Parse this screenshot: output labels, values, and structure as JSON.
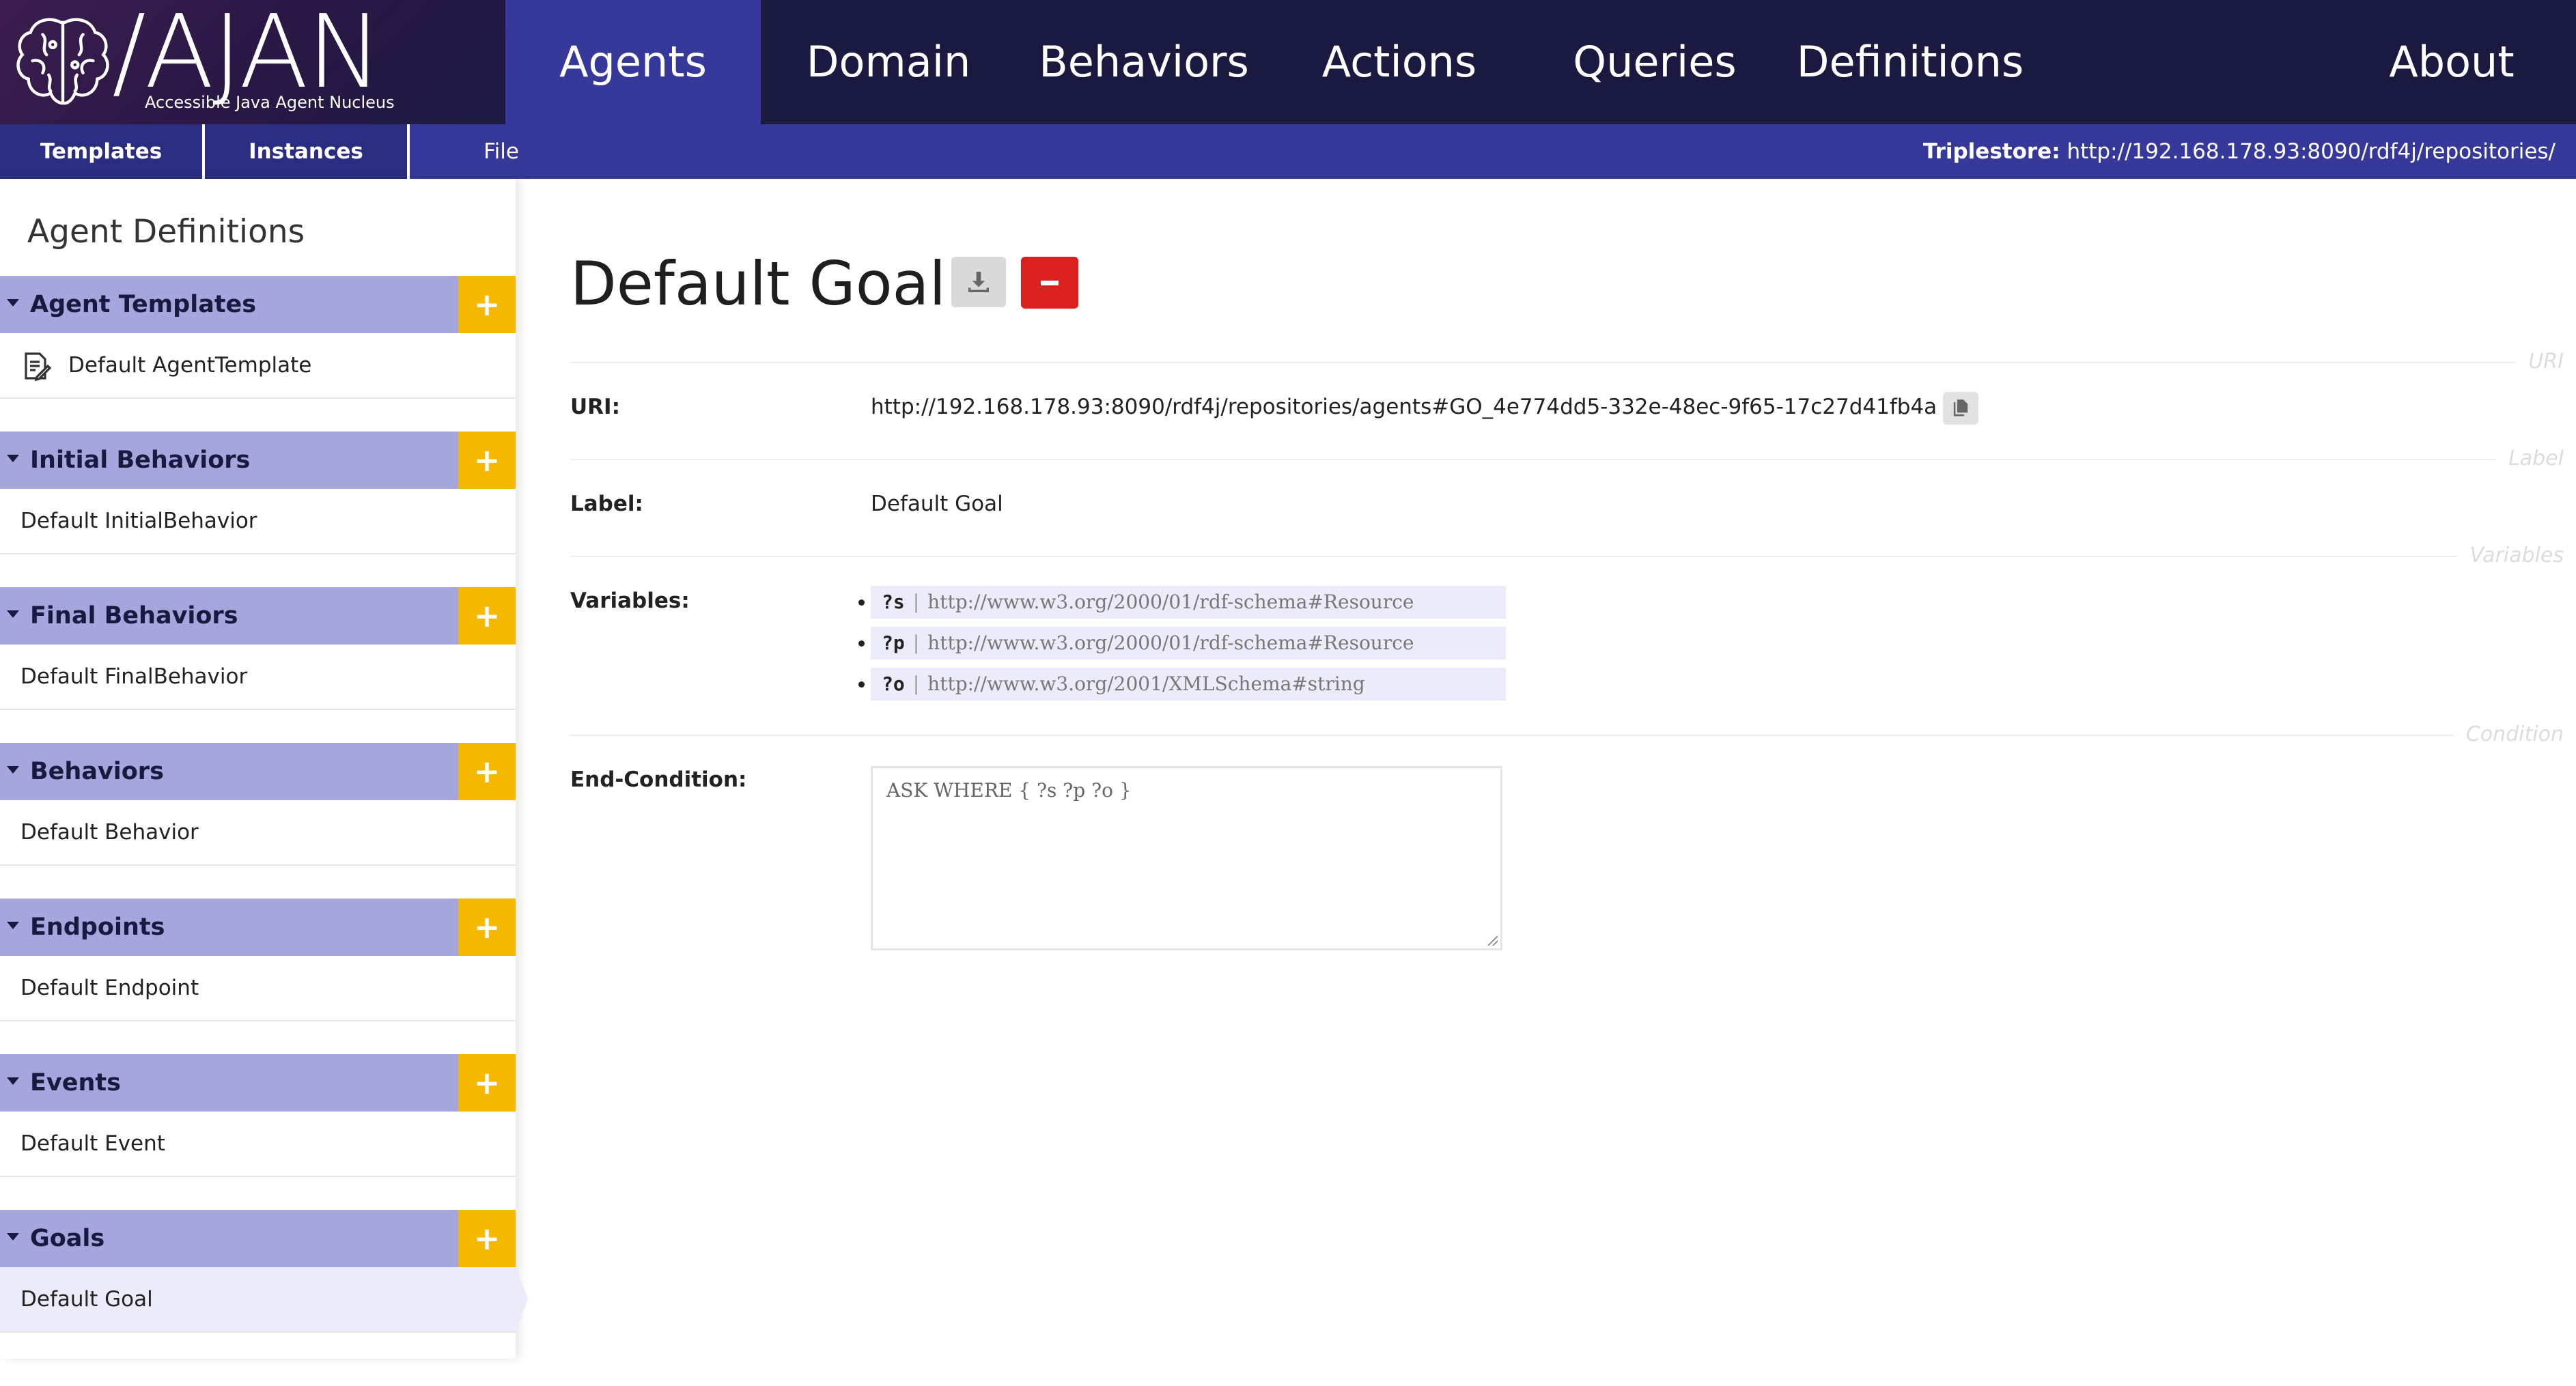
{
  "app": {
    "logo_text": "/AJAN",
    "logo_subtitle": "Accessible Java Agent Nucleus"
  },
  "nav": {
    "items": [
      {
        "label": "Agents",
        "active": true
      },
      {
        "label": "Domain"
      },
      {
        "label": "Behaviors"
      },
      {
        "label": "Actions"
      },
      {
        "label": "Queries"
      },
      {
        "label": "Definitions"
      },
      {
        "label": "About"
      }
    ]
  },
  "subnav": {
    "tabs": [
      {
        "label": "Templates"
      },
      {
        "label": "Instances"
      },
      {
        "label": "File"
      }
    ],
    "triplestore_label": "Triplestore:",
    "triplestore_url": "http://192.168.178.93:8090/rdf4j/repositories/"
  },
  "sidebar": {
    "title": "Agent Definitions",
    "add_label": "+",
    "sections": [
      {
        "label": "Agent Templates",
        "item": "Default AgentTemplate"
      },
      {
        "label": "Initial Behaviors",
        "item": "Default InitialBehavior"
      },
      {
        "label": "Final Behaviors",
        "item": "Default FinalBehavior"
      },
      {
        "label": "Behaviors",
        "item": "Default Behavior"
      },
      {
        "label": "Endpoints",
        "item": "Default Endpoint"
      },
      {
        "label": "Events",
        "item": "Default Event"
      },
      {
        "label": "Goals",
        "item": "Default Goal",
        "selected": true
      }
    ]
  },
  "main": {
    "title": "Default Goal",
    "separators": {
      "uri": "URI",
      "label": "Label",
      "variables": "Variables",
      "condition": "Condition"
    },
    "uri_label": "URI:",
    "uri_value": "http://192.168.178.93:8090/rdf4j/repositories/agents#GO_4e774dd5-332e-48ec-9f65-17c27d41fb4a",
    "label_label": "Label:",
    "label_value": "Default Goal",
    "variables_label": "Variables:",
    "variables": [
      {
        "name": "?s",
        "type": "http://www.w3.org/2000/01/rdf-schema#Resource"
      },
      {
        "name": "?p",
        "type": "http://www.w3.org/2000/01/rdf-schema#Resource"
      },
      {
        "name": "?o",
        "type": "http://www.w3.org/2001/XMLSchema#string"
      }
    ],
    "variable_separator": "|",
    "end_condition_label": "End-Condition:",
    "end_condition_value": "ASK WHERE { ?s ?p ?o }"
  },
  "colors": {
    "nav_bg": "#1a1a40",
    "nav_active": "#37399a",
    "section_header": "#a6a6de",
    "add_button": "#f5b800",
    "delete_button": "#dc2020"
  },
  "icons": {
    "logo": "brain-icon",
    "template_item": "document-edit-icon",
    "download": "download-icon",
    "delete": "minus-icon",
    "copy": "copy-icon",
    "section_toggle": "caret-down-icon"
  }
}
